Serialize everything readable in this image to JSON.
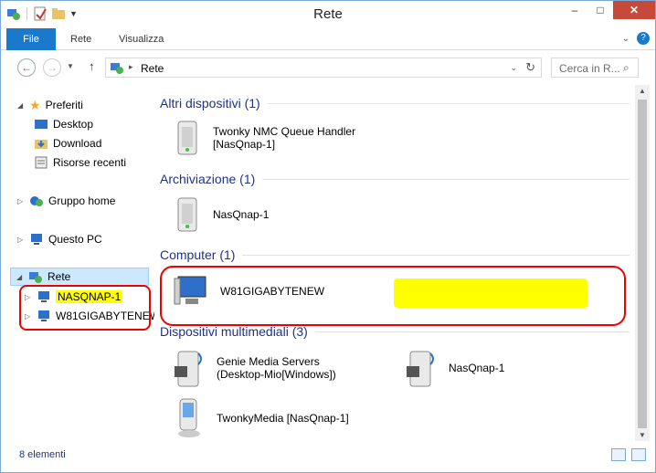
{
  "window": {
    "title": "Rete"
  },
  "titlebar": {
    "minimize": "–",
    "maximize": "□",
    "close": "✕"
  },
  "ribbon": {
    "tabs": [
      "File",
      "Rete",
      "Visualizza"
    ],
    "help": "?"
  },
  "address": {
    "path": "Rete",
    "separator": "▸",
    "search_placeholder": "Cerca in R..."
  },
  "nav": {
    "favorites": "Preferiti",
    "desktop": "Desktop",
    "download": "Download",
    "recent": "Risorse recenti",
    "homegroup": "Gruppo home",
    "thispc": "Questo PC",
    "network": "Rete",
    "nas": "NASQNAP-1",
    "pc": "W81GIGABYTENEW"
  },
  "groups": [
    {
      "title": "Altri dispositivi (1)"
    },
    {
      "title": "Archiviazione (1)"
    },
    {
      "title": "Computer (1)"
    },
    {
      "title": "Dispositivi multimediali (3)"
    }
  ],
  "items": {
    "twonky_queue_1": "Twonky NMC Queue Handler",
    "twonky_queue_2": "[NasQnap-1]",
    "nas_storage": "NasQnap-1",
    "computer": "W81GIGABYTENEW",
    "genie_1": "Genie Media Servers",
    "genie_2": "(Desktop-Mio[Windows])",
    "nas_media": "NasQnap-1",
    "twonkymedia": "TwonkyMedia [NasQnap-1]"
  },
  "status": {
    "count": "8 elementi"
  },
  "colors": {
    "highlight": "#ffff00",
    "annotation": "#e00000",
    "group_header": "#1e3287",
    "file_tab": "#1979ca"
  }
}
